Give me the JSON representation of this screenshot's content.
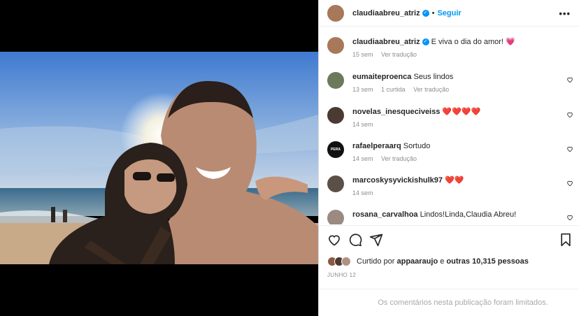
{
  "post": {
    "username": "claudiaabreu_atriz",
    "separator": "•",
    "follow_label": "Seguir",
    "more_label": "•••",
    "caption": {
      "username": "claudiaabreu_atriz",
      "text": "E viva o dia do amor! 💗",
      "time": "15 sem",
      "translate": "Ver tradução"
    }
  },
  "comments": [
    {
      "username": "eumaiteproenca",
      "text": "Seus lindos",
      "time": "13 sem",
      "likes": "1 curtida",
      "translate": "Ver tradução",
      "avatar_color": "#6b7a5a"
    },
    {
      "username": "novelas_inesqueciveiss",
      "text": "❤️❤️❤️❤️",
      "time": "14 sem",
      "likes": "",
      "translate": "",
      "avatar_color": "#4a3a32"
    },
    {
      "username": "rafaelperaarq",
      "text": "Sortudo",
      "time": "14 sem",
      "likes": "",
      "translate": "Ver tradução",
      "avatar_color": "#111111",
      "avatar_text": "PERA"
    },
    {
      "username": "marcoskysyvickishulk97",
      "text": "❤️❤️",
      "time": "14 sem",
      "likes": "",
      "translate": "",
      "avatar_color": "#5a5048"
    },
    {
      "username": "rosana_carvalhoa",
      "text": "Lindos!Linda,Claudia Abreu!",
      "time": "",
      "likes": "",
      "translate": "",
      "avatar_color": "#9a8a80"
    }
  ],
  "likes": {
    "prefix": "Curtido por",
    "user": "appaaraujo",
    "middle": "e",
    "others": "outras 10,315 pessoas"
  },
  "date": "JUNHO 12",
  "limited_text": "Os comentários nesta publicação foram limitados.",
  "colors": {
    "accent": "#0095f6",
    "heart": "#ed4956",
    "muted": "#8e8e8e"
  }
}
